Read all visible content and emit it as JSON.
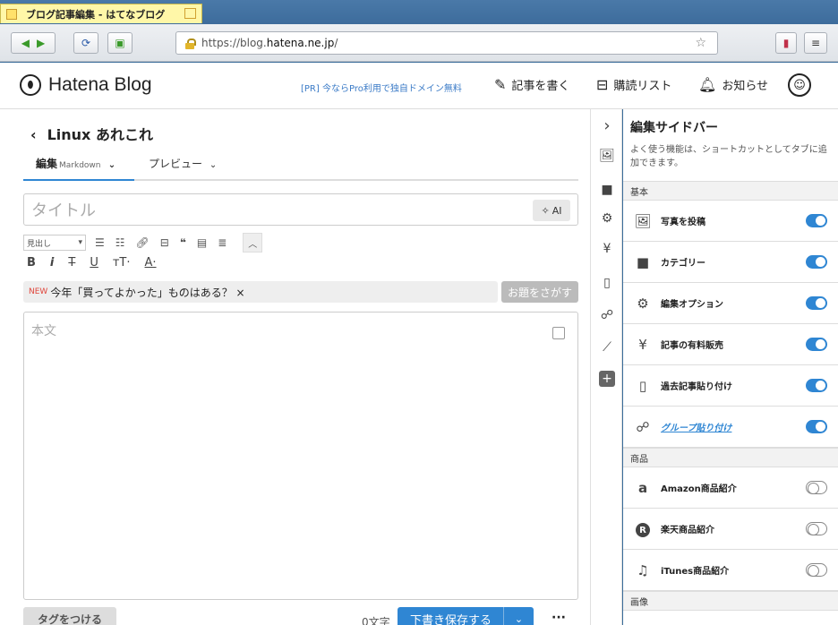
{
  "window": {
    "title": "ブログ記事編集 - はてなブログ"
  },
  "browser": {
    "url_prefix": "https://blog.",
    "url_host": "hatena.ne.jp",
    "url_suffix": "/"
  },
  "header": {
    "logo": "Hatena Blog",
    "promo": "[PR] 今ならPro利用で独自ドメイン無料",
    "write": "記事を書く",
    "subscriptions": "購読リスト",
    "notifications": "お知らせ"
  },
  "editor": {
    "back_label": "Linux あれこれ",
    "tab_edit": "編集",
    "tab_edit_mode": "Markdown",
    "tab_preview": "プレビュー",
    "title_placeholder": "タイトル",
    "ai_button": "AI",
    "heading_select": "見出し",
    "topic_new": "NEW",
    "topic_text": "今年「買ってよかった」ものはある？ ×",
    "topic_button": "お題をさがす",
    "body_placeholder": "本文",
    "tag_button": "タグをつける",
    "char_count": "0文字",
    "save_button": "下書き保存する",
    "more": "···"
  },
  "sidebar": {
    "title": "編集サイドバー",
    "description": "よく使う機能は、ショートカットとしてタブに追加できます。",
    "sections": [
      {
        "label": "基本",
        "items": [
          {
            "label": "写真を投稿",
            "icon": "photo-icon",
            "enabled": true
          },
          {
            "label": "カテゴリー",
            "icon": "folder-icon",
            "enabled": true
          },
          {
            "label": "編集オプション",
            "icon": "gear-icon",
            "enabled": true
          },
          {
            "label": "記事の有料販売",
            "icon": "yen-icon",
            "enabled": true
          },
          {
            "label": "過去記事貼り付け",
            "icon": "document-icon",
            "enabled": true
          },
          {
            "label": "グループ貼り付け",
            "icon": "group-icon",
            "enabled": true
          }
        ]
      },
      {
        "label": "商品",
        "items": [
          {
            "label": "Amazon商品紹介",
            "icon": "amazon-icon",
            "enabled": false
          },
          {
            "label": "楽天商品紹介",
            "icon": "rakuten-icon",
            "enabled": false
          },
          {
            "label": "iTunes商品紹介",
            "icon": "music-icon",
            "enabled": false
          }
        ]
      },
      {
        "label": "画像",
        "items": []
      }
    ]
  },
  "colors": {
    "accent": "#2f86d3",
    "promo": "#3b7bc7",
    "new_badge": "#e0463c"
  }
}
